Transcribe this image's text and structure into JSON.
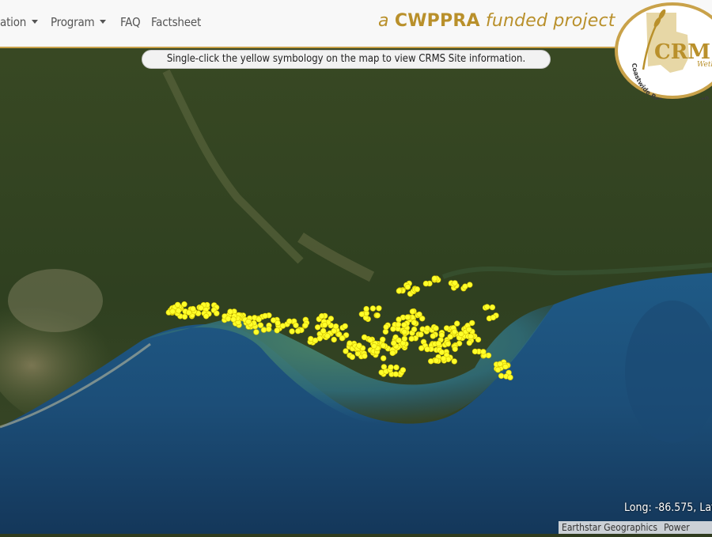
{
  "nav": {
    "items": [
      {
        "label": "ation",
        "dropdown": true
      },
      {
        "label": "Program",
        "dropdown": true
      },
      {
        "label": "FAQ",
        "dropdown": false
      },
      {
        "label": "Factsheet",
        "dropdown": false
      }
    ]
  },
  "tagline": {
    "prefix": "a ",
    "brand": "CWPPRA",
    "suffix": " funded project"
  },
  "logo": {
    "text_main": "CRM",
    "text_sub": "Wetla",
    "ring_text": "Coastwide Reference Monito"
  },
  "banner": {
    "text": "Single-click the yellow symbology on the map to view CRMS Site information."
  },
  "coords": {
    "text": "Long: -86.575, Lat"
  },
  "attribution": {
    "provider": "Earthstar Geographics",
    "powered": "Power"
  },
  "colors": {
    "accent": "#b9902b",
    "site_marker": "#ffff2a",
    "navbar_bg": "#f8f8f8"
  },
  "map": {
    "basemap": "satellite",
    "marker_symbol": "yellow-circle",
    "marker_style": "dense clusters of CRMS site markers along the Louisiana coast"
  }
}
